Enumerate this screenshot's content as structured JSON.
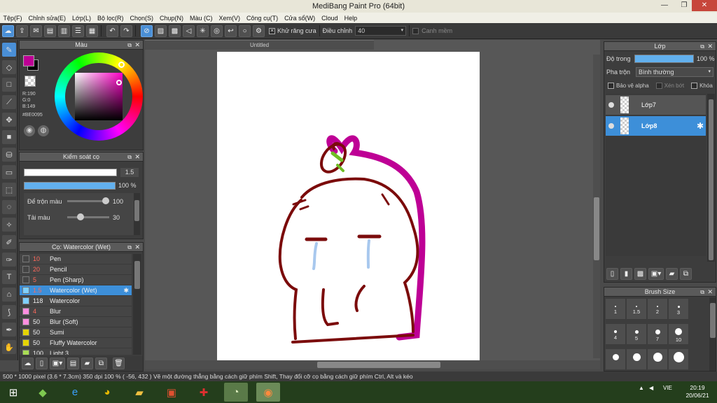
{
  "window": {
    "title": "MediBang Paint Pro (64bit)"
  },
  "menu": [
    "Tệp(F)",
    "Chỉnh sửa(E)",
    "Lớp(L)",
    "Bộ lọc(R)",
    "Chọn(S)",
    "Chụp(N)",
    "Màu (C)",
    "Xem(V)",
    "Công cụ(T)",
    "Cửa sổ(W)",
    "Cloud",
    "Help"
  ],
  "toolbar": {
    "antialias_label": "Khử răng cưa",
    "correction_label": "Điều chỉnh",
    "correction_value": "40",
    "edge_label": "Canh mềm"
  },
  "color_panel": {
    "title": "Màu",
    "r": "R:190",
    "g": "G:0",
    "b": "B:149",
    "hex": "#BE0095",
    "fg_color": "#be0095"
  },
  "brush_control": {
    "title": "Kiểm soát cọ",
    "size_value": "1.5",
    "opacity_value": "100 %",
    "blend_label": "Để trộn màu",
    "blend_value": "100",
    "amount_label": "Tải màu",
    "amount_value": "30"
  },
  "brush_list": {
    "title": "Cọ: Watercolor (Wet)",
    "items": [
      {
        "size": "10",
        "name": "Pen",
        "color": "#444444"
      },
      {
        "size": "20",
        "name": "Pencil",
        "color": "#444444"
      },
      {
        "size": "5",
        "name": "Pen (Sharp)",
        "color": "#444444"
      },
      {
        "size": "1.5",
        "name": "Watercolor (Wet)",
        "color": "#7fd0ff",
        "selected": true
      },
      {
        "size": "118",
        "name": "Watercolor",
        "color": "#7fd0ff"
      },
      {
        "size": "4",
        "name": "Blur",
        "color": "#ff8fe0"
      },
      {
        "size": "50",
        "name": "Blur (Soft)",
        "color": "#ff8fe0"
      },
      {
        "size": "50",
        "name": "Sumi",
        "color": "#e6d400"
      },
      {
        "size": "50",
        "name": "Fluffy Watercolor",
        "color": "#e6d400"
      },
      {
        "size": "100",
        "name": "Light 3",
        "color": "#aadd55"
      }
    ]
  },
  "document": {
    "tab_title": "Untitled"
  },
  "layer_panel": {
    "title": "Lớp",
    "opacity_label": "Độ trong",
    "opacity_value": "100 %",
    "opacity_level": 1.0,
    "blend_label": "Pha trộn",
    "blend_value": "Bình thường",
    "protect_alpha": "Bảo vệ alpha",
    "clip": "Xén bớt",
    "lock": "Khóa",
    "layers": [
      {
        "name": "Lớp7",
        "selected": false
      },
      {
        "name": "Lớp8",
        "selected": true
      }
    ]
  },
  "brush_size_panel": {
    "title": "Brush Size",
    "sizes": [
      "1",
      "1.5",
      "2",
      "3",
      "4",
      "5",
      "7",
      "10",
      "",
      "",
      "",
      ""
    ]
  },
  "status": {
    "text": "500 * 1000 pixel   (3.6 * 7.3cm)   350 dpi   100 %   ( -56, 432 )   Vẽ một đường thẳng bằng cách giữ phím Shift, Thay đổi cỡ cọ bằng cách giữ phím Ctrl, Alt và kéo"
  },
  "taskbar": {
    "lang": "VIE",
    "time": "20:19",
    "date": "20/06/21"
  }
}
